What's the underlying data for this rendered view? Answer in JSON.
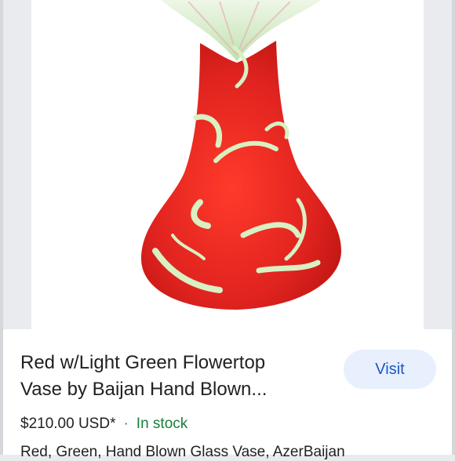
{
  "listing": {
    "title_line1": "Red w/Light Green Flowertop",
    "title_line2": "Vase by Baijan Hand Blown...",
    "visit_label": "Visit",
    "price": "$210.00 USD*",
    "separator": "·",
    "stock_status": "In stock",
    "description": "Red, Green, Hand Blown Glass Vase, AzerBaijan"
  },
  "product_image": {
    "subject": "red-glass-vase-with-green-swirls",
    "colors": {
      "glass": "#e0231f",
      "swirl": "#d8f0c2",
      "flower_top": "#cfeac6"
    }
  },
  "colors": {
    "visit_bg": "#e8f0fe",
    "visit_text": "#1a56c4",
    "in_stock": "#188038"
  }
}
